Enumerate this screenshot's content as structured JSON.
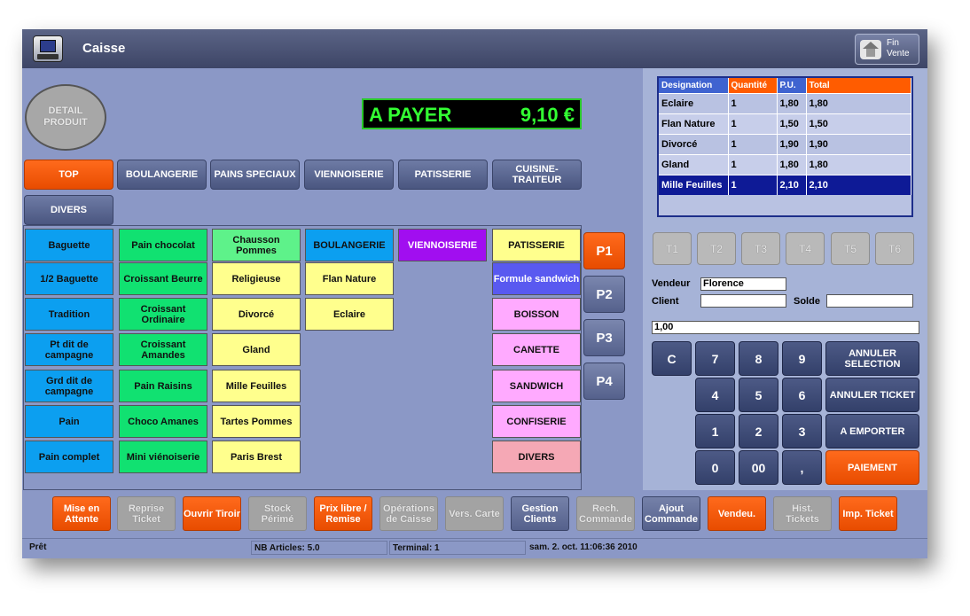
{
  "window": {
    "title": "Caisse",
    "fin_vente": "Fin Vente"
  },
  "detail_produit": "DETAIL PRODUIT",
  "a_payer": {
    "label": "A PAYER",
    "amount": "9,10 €"
  },
  "categories": [
    "TOP",
    "BOULANGERIE",
    "PAINS SPECIAUX",
    "VIENNOISERIE",
    "PATISSERIE",
    "CUISINE-TRAITEUR",
    "DIVERS"
  ],
  "products": {
    "col1": [
      "Baguette",
      "1/2 Baguette",
      "Tradition",
      "Pt dit de campagne",
      "Grd dit de campagne",
      "Pain",
      "Pain complet"
    ],
    "col2": [
      "Pain chocolat",
      "Croissant Beurre",
      "Croissant Ordinaire",
      "Croissant Amandes",
      "Pain Raisins",
      "Choco Amanes",
      "Mini viénoiserie"
    ],
    "col3": [
      "Chausson Pommes",
      "Religieuse",
      "Divorcé",
      "Gland",
      "Mille Feuilles",
      "Tartes Pommes",
      "Paris Brest"
    ],
    "col4": [
      "BOULANGERIE",
      "Flan Nature",
      "Eclaire"
    ],
    "col5": [
      "VIENNOISERIE"
    ],
    "col6": [
      "PATISSERIE",
      "Formule sandwich",
      "BOISSON",
      "CANETTE",
      "SANDWICH",
      "CONFISERIE",
      "DIVERS"
    ]
  },
  "pages": [
    "P1",
    "P2",
    "P3",
    "P4"
  ],
  "ticket": {
    "headers": [
      "Designation",
      "Quantité",
      "P.U.",
      "Total"
    ],
    "rows": [
      [
        "Eclaire",
        "1",
        "1,80",
        "1,80"
      ],
      [
        "Flan Nature",
        "1",
        "1,50",
        "1,50"
      ],
      [
        "Divorcé",
        "1",
        "1,90",
        "1,90"
      ],
      [
        "Gland",
        "1",
        "1,80",
        "1,80"
      ],
      [
        "Mille Feuilles",
        "1",
        "2,10",
        "2,10"
      ]
    ]
  },
  "tables": [
    "T1",
    "T2",
    "T3",
    "T4",
    "T5",
    "T6"
  ],
  "vendeur": {
    "label": "Vendeur",
    "value": "Florence"
  },
  "client": {
    "label": "Client",
    "value": ""
  },
  "solde": {
    "label": "Solde",
    "value": ""
  },
  "input_value": "1,00",
  "keypad": {
    "c": "C",
    "k7": "7",
    "k8": "8",
    "k9": "9",
    "k4": "4",
    "k5": "5",
    "k6": "6",
    "k1": "1",
    "k2": "2",
    "k3": "3",
    "k0": "0",
    "k00": "00",
    "comma": ",",
    "annuler_selection": "ANNULER SELECTION",
    "annuler_ticket": "ANNULER TICKET",
    "a_emporter": "A EMPORTER",
    "paiement": "PAIEMENT"
  },
  "bottom_buttons": [
    "Mise en Attente",
    "Reprise Ticket",
    "Ouvrir Tiroir",
    "Stock Périmé",
    "Prix libre / Remise",
    "Opérations de Caisse",
    "Vers. Carte",
    "Gestion Clients",
    "Rech. Commande",
    "Ajout Commande",
    "Vendeu.",
    "Hist. Tickets",
    "Imp. Ticket"
  ],
  "status": {
    "state": "Prêt",
    "nb_articles": "NB Articles: 5.0",
    "terminal": "Terminal: 1",
    "datetime": "sam. 2. oct. 11:06:36 2010"
  },
  "colors": {
    "accent": "#ff5c00",
    "panel": "#8b98c6",
    "selected_row": "#0e1a96"
  }
}
